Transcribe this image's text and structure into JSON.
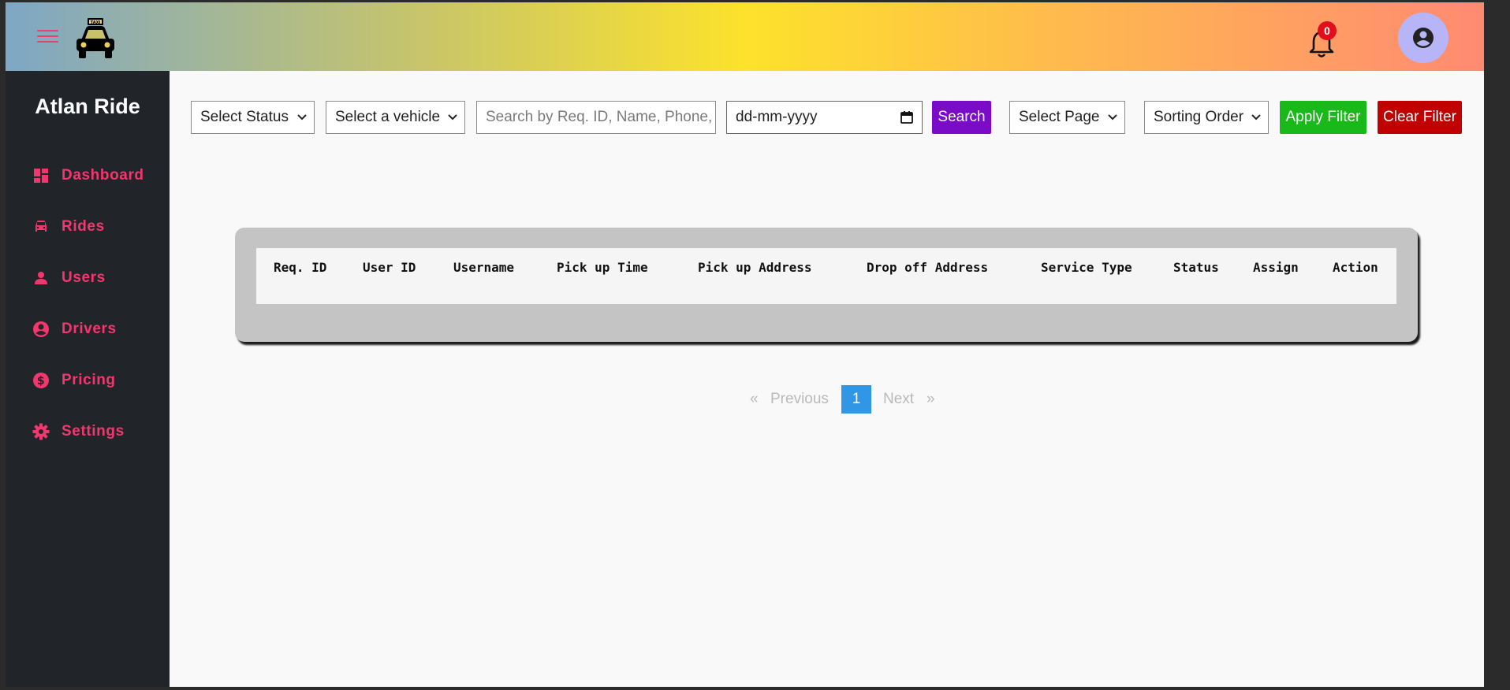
{
  "app": {
    "brand": "Atlan Ride"
  },
  "header": {
    "notification_count": "0",
    "colors": {
      "gradient_start": "#7ea7c5",
      "gradient_mid": "#fde22b",
      "gradient_end": "#ff8a72"
    }
  },
  "sidebar": {
    "items": [
      {
        "label": "Dashboard",
        "icon": "dashboard-icon"
      },
      {
        "label": "Rides",
        "icon": "car-icon"
      },
      {
        "label": "Users",
        "icon": "user-icon"
      },
      {
        "label": "Drivers",
        "icon": "driver-icon"
      },
      {
        "label": "Pricing",
        "icon": "dollar-icon"
      },
      {
        "label": "Settings",
        "icon": "gear-icon"
      }
    ],
    "accent": "#f4366f"
  },
  "filters": {
    "status_select": "Select Status",
    "vehicle_select": "Select a vehicle",
    "search_placeholder": "Search by Req. ID, Name, Phone, P",
    "date_value": "dd-mm-yyyy",
    "search_button": "Search",
    "page_select": "Select Page",
    "sort_select": "Sorting Order",
    "apply_button": "Apply Filter",
    "clear_button": "Clear Filter",
    "colors": {
      "search": "#7a0bc6",
      "apply": "#19b919",
      "clear": "#c10000"
    }
  },
  "table": {
    "columns": [
      "Req. ID",
      "User ID",
      "Username",
      "Pick up Time",
      "Pick up Address",
      "Drop off Address",
      "Service Type",
      "Status",
      "Assign",
      "Action"
    ],
    "rows": []
  },
  "pagination": {
    "prev_symbol": "«",
    "prev_label": "Previous",
    "current_page": "1",
    "next_label": "Next",
    "next_symbol": "»"
  }
}
